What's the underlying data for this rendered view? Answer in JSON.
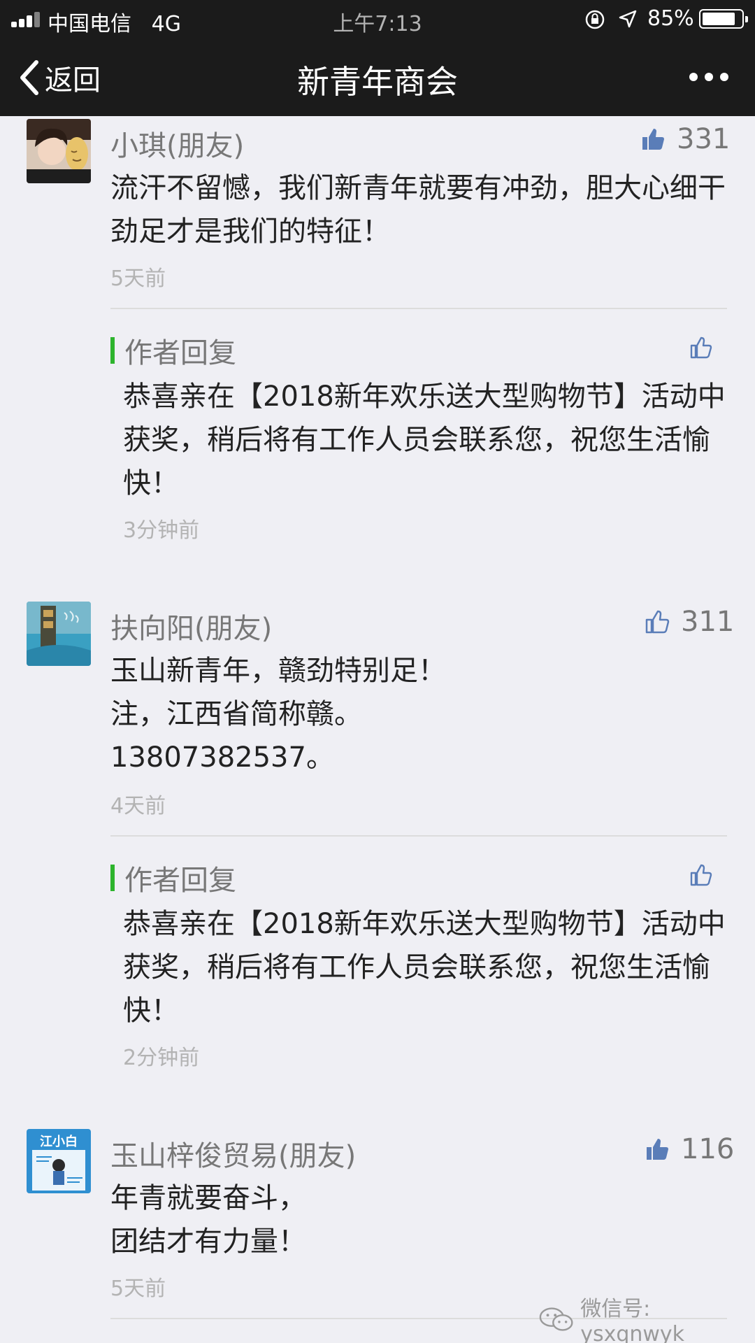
{
  "status_bar": {
    "carrier": "中国电信",
    "network": "4G",
    "time": "上午7:13",
    "battery": "85%",
    "battery_level": 0.85
  },
  "nav": {
    "back_label": "返回",
    "title": "新青年商会"
  },
  "comments": [
    {
      "nickname": "小琪(朋友)",
      "likes": "331",
      "text": "流汗不留憾，我们新青年就要有冲劲，胆大心细干劲足才是我们的特征！",
      "time": "5天前",
      "reply": {
        "label": "作者回复",
        "text": "恭喜亲在【2018新年欢乐送大型购物节】活动中获奖，稍后将有工作人员会联系您，祝您生活愉快！",
        "time": "3分钟前"
      }
    },
    {
      "nickname": "扶向阳(朋友)",
      "likes": "311",
      "text": "玉山新青年，赣劲特别足！\n注，江西省简称赣。\n13807382537。",
      "time": "4天前",
      "reply": {
        "label": "作者回复",
        "text": "恭喜亲在【2018新年欢乐送大型购物节】活动中获奖，稍后将有工作人员会联系您，祝您生活愉快！",
        "time": "2分钟前"
      }
    },
    {
      "nickname": "玉山梓俊贸易(朋友)",
      "likes": "116",
      "text": "年青就要奋斗，\n团结才有力量！",
      "time": "5天前"
    }
  ],
  "avatar_text": {
    "third_brand": "江小白"
  },
  "watermark": "微信号: ysxqnwyk",
  "colors": {
    "bar_background": "#1b1b1b",
    "page_background": "#efeff4",
    "reply_accent": "#2db42d",
    "like_icon": "#5a7db8"
  }
}
